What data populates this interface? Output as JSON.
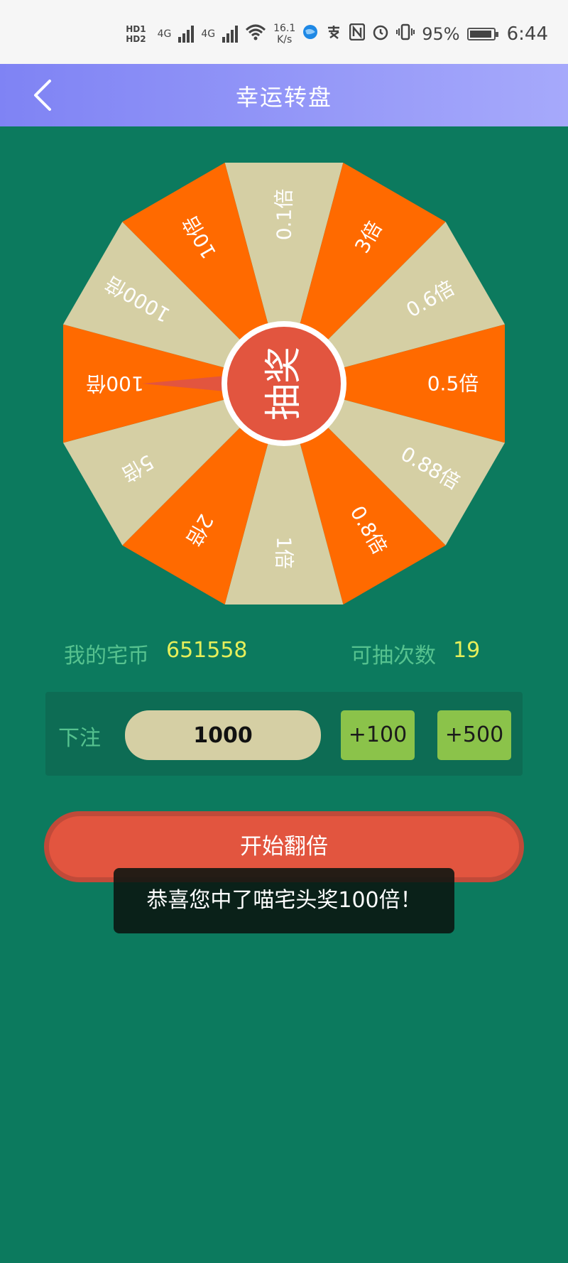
{
  "status_bar": {
    "hd1": "HD1",
    "hd2": "HD2",
    "net1": "4G",
    "net2": "4G",
    "speed_value": "16.1",
    "speed_unit": "K/s",
    "battery_pct_text": "95%",
    "battery_level": 0.95,
    "time": "6:44"
  },
  "header": {
    "title": "幸运转盘"
  },
  "wheel": {
    "center_label": "抽奖",
    "colors": {
      "orange": "#ff6a00",
      "beige": "#d5cfa4",
      "center": "#e2553f",
      "rim": "#ffffff"
    },
    "segments": [
      "0.1倍",
      "3倍",
      "0.6倍",
      "0.5倍",
      "0.88倍",
      "0.8倍",
      "1倍",
      "2倍",
      "5倍",
      "100倍",
      "1000倍",
      "10倍"
    ]
  },
  "stats": {
    "coins_label": "我的宅币",
    "coins_value": "651558",
    "draws_label": "可抽次数",
    "draws_value": "19"
  },
  "bet": {
    "label": "下注",
    "value": "1000",
    "add100_label": "+100",
    "add500_label": "+500"
  },
  "start_button": "开始翻倍",
  "toast": "恭喜您中了喵宅头奖100倍！"
}
